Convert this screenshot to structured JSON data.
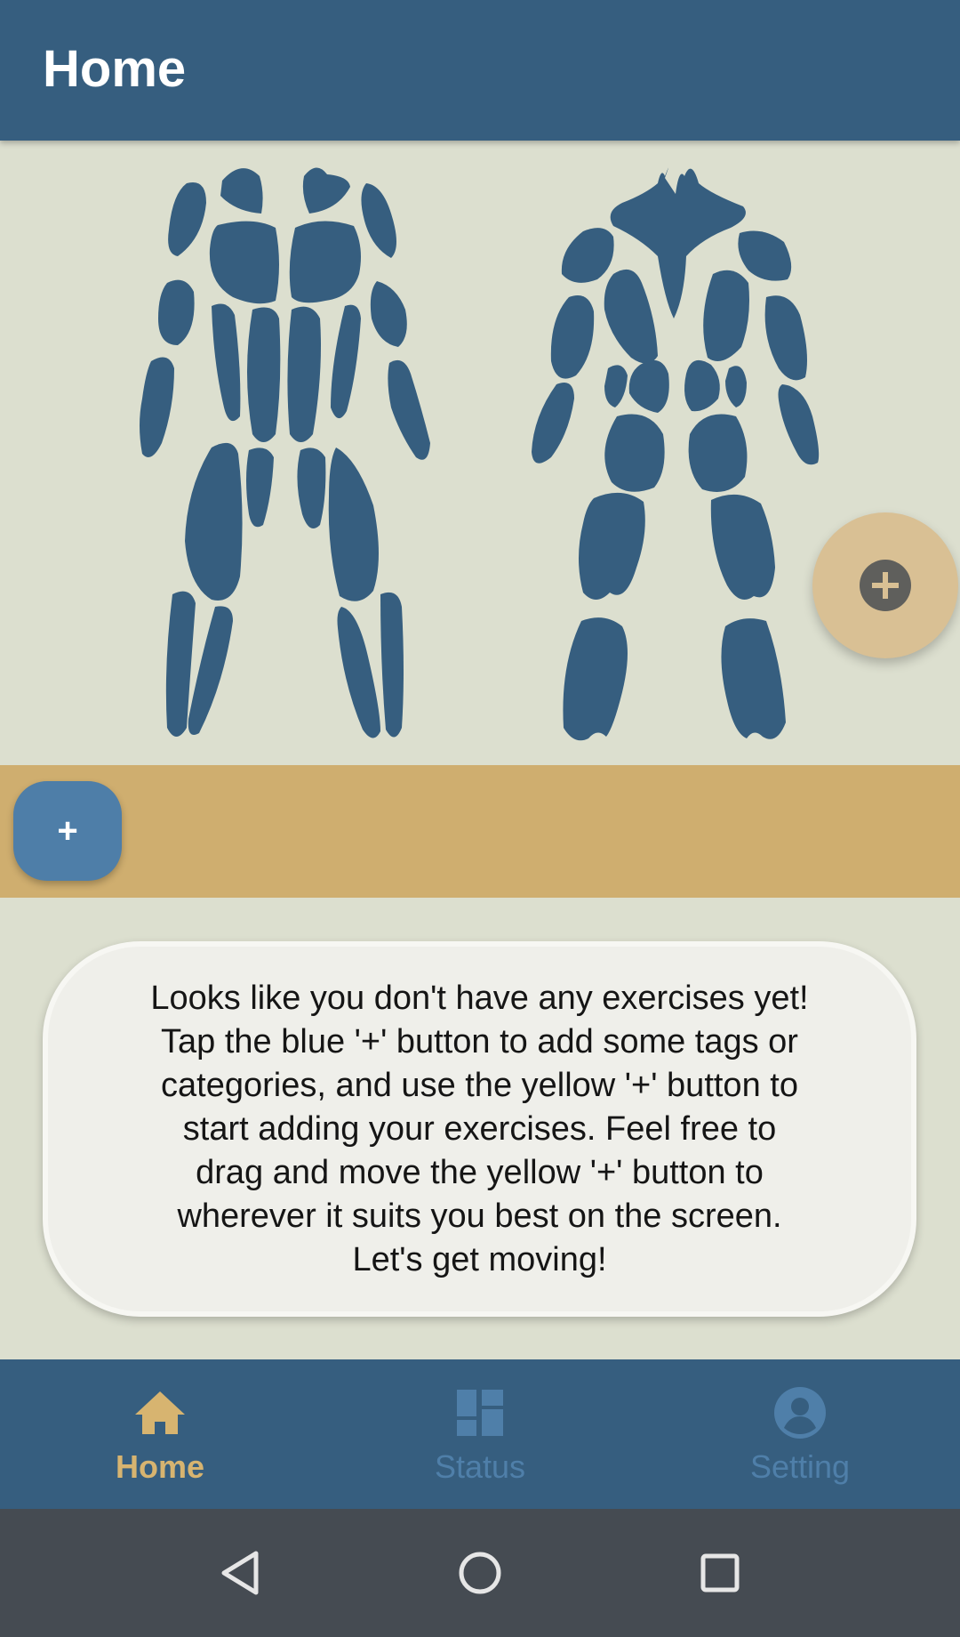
{
  "app_bar": {
    "title": "Home"
  },
  "body_map": {
    "front_label": "front-muscle-figure",
    "back_label": "back-muscle-figure",
    "muscle_color": "#365e7f"
  },
  "fab": {
    "icon": "plus-circle-icon",
    "color": "#d9c094"
  },
  "tag_bar": {
    "add_button_label": "+",
    "button_color": "#4e7ea8",
    "strip_color": "#cfae6f"
  },
  "empty_message": "Looks like you don't have any exercises yet! Tap the blue '+' button to add some tags or categories, and use the yellow '+' button to start adding your exercises. Feel free to drag and move the yellow '+' button to wherever it suits you best on the screen. Let's get moving!",
  "bottom_nav": {
    "items": [
      {
        "label": "Home",
        "icon": "home-icon",
        "active": true
      },
      {
        "label": "Status",
        "icon": "dashboard-icon",
        "active": false
      },
      {
        "label": "Setting",
        "icon": "account-circle-icon",
        "active": false
      }
    ],
    "active_color": "#d7b470",
    "inactive_color": "#4f7fa9"
  },
  "system_nav": {
    "icons": [
      "back-triangle-icon",
      "home-circle-icon",
      "recents-square-icon"
    ]
  }
}
